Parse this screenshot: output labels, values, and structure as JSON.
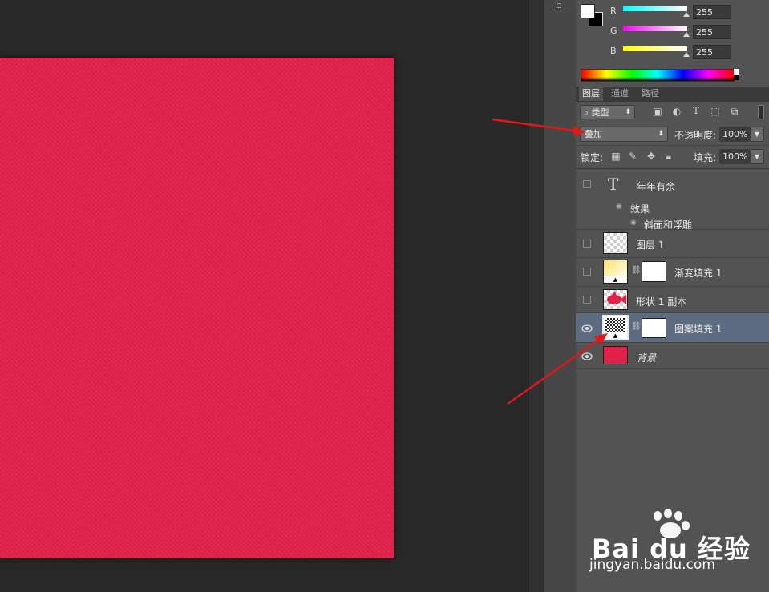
{
  "colors": {
    "canvas_fill": "#e2214a",
    "selection_bg": "#5d6c80",
    "arrow": "#e01818"
  },
  "toolbar": {
    "tool_glyph": "▫"
  },
  "color_panel": {
    "channels": [
      {
        "label": "R",
        "value": "255",
        "gradient": [
          "#00ffff",
          "#ffffff"
        ]
      },
      {
        "label": "G",
        "value": "255",
        "gradient": [
          "#ff00ff",
          "#ffffff"
        ]
      },
      {
        "label": "B",
        "value": "255",
        "gradient": [
          "#ffff00",
          "#ffffff"
        ]
      }
    ]
  },
  "tabs": [
    {
      "label": "图层",
      "active": true
    },
    {
      "label": "通道",
      "active": false
    },
    {
      "label": "路径",
      "active": false
    }
  ],
  "layers_panel": {
    "filter_kind": "类型",
    "blend_mode": "叠加",
    "opacity_label": "不透明度:",
    "opacity_value": "100%",
    "lock_label": "锁定:",
    "fill_label": "填充:",
    "fill_value": "100%",
    "layers": [
      {
        "name": "年年有余",
        "type": "text",
        "effects_label": "效果",
        "effect": "斜面和浮雕",
        "visible": false
      },
      {
        "name": "图层 1",
        "type": "pixel",
        "visible": false
      },
      {
        "name": "渐变填充 1",
        "type": "gradient-fill",
        "visible": false
      },
      {
        "name": "形状 1 副本",
        "type": "shape",
        "visible": false
      },
      {
        "name": "图案填充 1",
        "type": "pattern-fill",
        "visible": true,
        "selected": true
      },
      {
        "name": "背景",
        "type": "background",
        "visible": true
      }
    ]
  },
  "watermark": {
    "brand": "Bai  du 经验",
    "url": "jingyan.baidu.com"
  }
}
